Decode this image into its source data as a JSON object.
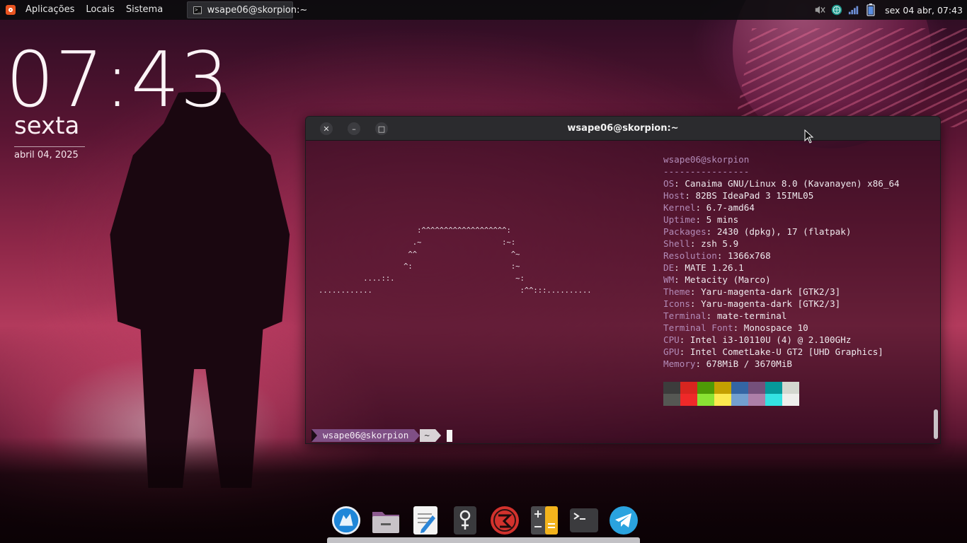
{
  "top_panel": {
    "menus": [
      "Aplicações",
      "Locais",
      "Sistema"
    ],
    "taskbar": {
      "label": "wsape06@skorpion:~",
      "icon": "terminal-icon"
    },
    "tray": {
      "icons": [
        "volume-muted-icon",
        "network-globe-icon",
        "signal-strength-icon",
        "battery-icon"
      ],
      "clock": "sex 04 abr, 07:43"
    }
  },
  "desktop_clock": {
    "time": "07:43",
    "day": "sexta",
    "date": "abril 04, 2025"
  },
  "terminal": {
    "title": "wsape06@skorpion:~",
    "buttons": [
      "close-icon",
      "minimize-icon",
      "maximize-icon"
    ],
    "neofetch": {
      "user_host": "wsape06@skorpion",
      "separator": "----------------",
      "lines": [
        {
          "key": "OS",
          "value": "Canaima GNU/Linux 8.0 (Kavanayen) x86_64"
        },
        {
          "key": "Host",
          "value": "82BS IdeaPad 3 15IML05"
        },
        {
          "key": "Kernel",
          "value": "6.7-amd64"
        },
        {
          "key": "Uptime",
          "value": "5 mins"
        },
        {
          "key": "Packages",
          "value": "2430 (dpkg), 17 (flatpak)"
        },
        {
          "key": "Shell",
          "value": "zsh 5.9"
        },
        {
          "key": "Resolution",
          "value": "1366x768"
        },
        {
          "key": "DE",
          "value": "MATE 1.26.1"
        },
        {
          "key": "WM",
          "value": "Metacity (Marco)"
        },
        {
          "key": "Theme",
          "value": "Yaru-magenta-dark [GTK2/3]"
        },
        {
          "key": "Icons",
          "value": "Yaru-magenta-dark [GTK2/3]"
        },
        {
          "key": "Terminal",
          "value": "mate-terminal"
        },
        {
          "key": "Terminal Font",
          "value": "Monospace 10"
        },
        {
          "key": "CPU",
          "value": "Intel i3-10110U (4) @ 2.100GHz"
        },
        {
          "key": "GPU",
          "value": "Intel CometLake-U GT2 [UHD Graphics]"
        },
        {
          "key": "Memory",
          "value": "678MiB / 3670MiB"
        }
      ],
      "ascii_art": "                      :^^^^^^^^^^^^^^^^^^^:\n                     .~                  :~:\n                    ^^                     ^~\n                   ^:                      :~\n          ....::.                           ~:\n............                                 :^^:::..........",
      "palette_top": [
        "#3c3c3c",
        "#d8251f",
        "#4e9a06",
        "#c4a000",
        "#3465a4",
        "#75507b",
        "#06989a",
        "#d3d7cf"
      ],
      "palette_bottom": [
        "#555753",
        "#ef2929",
        "#8ae234",
        "#fce94f",
        "#729fcf",
        "#ad7fa8",
        "#34e2e2",
        "#eeeeec"
      ]
    },
    "prompt": {
      "user": "wsape06@skorpion",
      "dir": "~"
    }
  },
  "dock": {
    "items": [
      {
        "name": "browser-launcher",
        "icon": "wolf-browser-icon"
      },
      {
        "name": "files-launcher",
        "icon": "folder-icon"
      },
      {
        "name": "text-editor-launcher",
        "icon": "text-editor-icon"
      },
      {
        "name": "settings-launcher",
        "icon": "tool-key-icon"
      },
      {
        "name": "canaima-launcher",
        "icon": "canaima-logo-icon"
      },
      {
        "name": "calculator-launcher",
        "icon": "calculator-icon"
      },
      {
        "name": "terminal-launcher",
        "icon": "terminal-icon"
      },
      {
        "name": "telegram-launcher",
        "icon": "telegram-icon"
      }
    ]
  },
  "colors": {
    "accent": "#7f4f85",
    "key_color": "#b38bb8",
    "panel": "#0c0c0e"
  }
}
